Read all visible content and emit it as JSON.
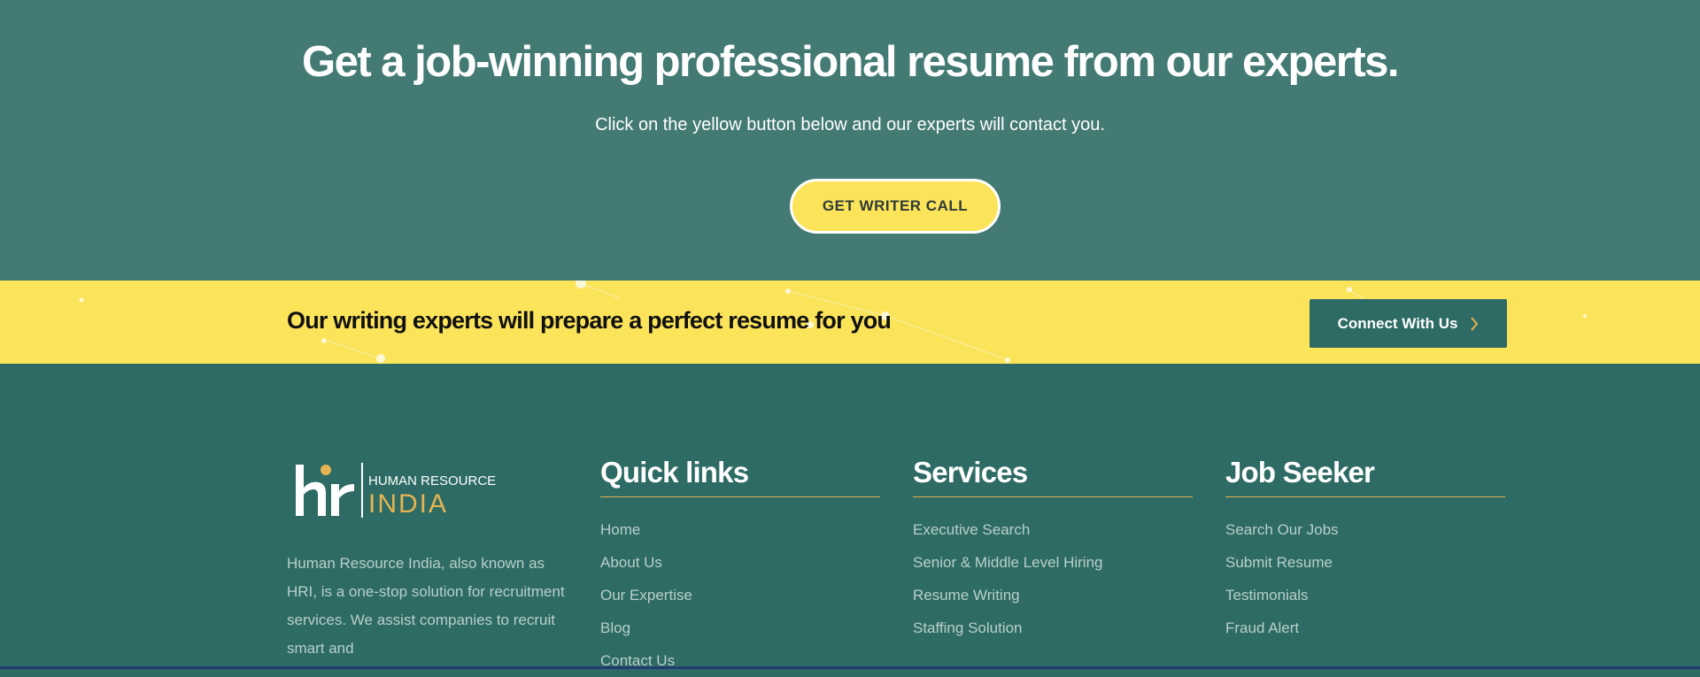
{
  "hero": {
    "title": "Get a job-winning professional resume from our experts.",
    "subtitle": "Click on the yellow button below and our experts will contact you.",
    "button_label": "GET WRITER CALL"
  },
  "band": {
    "text": "Our writing experts will prepare a perfect resume for you",
    "button_label": "Connect With Us",
    "button_icon": "chevron-right-icon"
  },
  "footer": {
    "logo": {
      "line1": "HUMAN RESOURCE",
      "line2": "INDIA"
    },
    "about": "Human Resource India, also known as HRI, is a one-stop solution for recruitment services. We assist companies to recruit smart and",
    "columns": [
      {
        "title": "Quick links",
        "items": [
          "Home",
          "About Us",
          "Our Expertise",
          "Blog",
          "Contact Us"
        ]
      },
      {
        "title": "Services",
        "items": [
          "Executive Search",
          "Senior & Middle Level Hiring",
          "Resume Writing",
          "Staffing Solution"
        ]
      },
      {
        "title": "Job Seeker",
        "items": [
          "Search Our Jobs",
          "Submit Resume",
          "Testimonials",
          "Fraud Alert"
        ]
      }
    ]
  },
  "colors": {
    "hero_bg": "#437a73",
    "band_bg": "#fbe45a",
    "footer_bg": "#2d6b64",
    "accent_gold": "#e6b451"
  }
}
